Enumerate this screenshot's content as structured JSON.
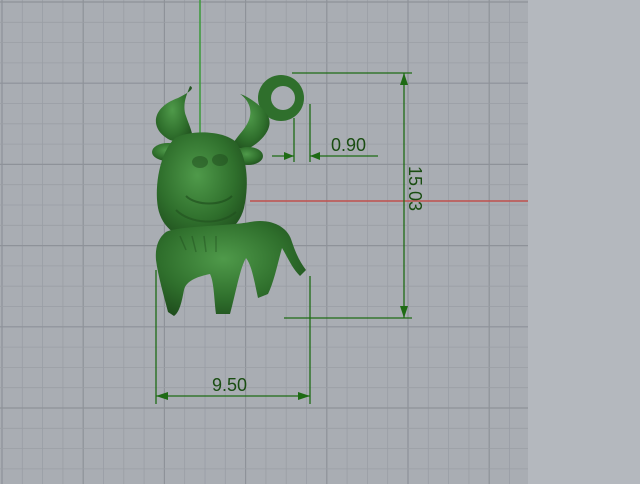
{
  "viewport": {
    "colors": {
      "background": "#a9adb3",
      "gridMinor": "#9a9ea5",
      "gridMajor": "#8e9299",
      "xAxis": "#c0504d",
      "yAxis": "#3a9a3a",
      "dimension": "#1e6b14",
      "model": "#2f6f2c",
      "sidePanel": "#b4b8be"
    }
  },
  "dimensions": {
    "ring_thickness": "0.90",
    "height": "15.03",
    "width": "9.50"
  }
}
